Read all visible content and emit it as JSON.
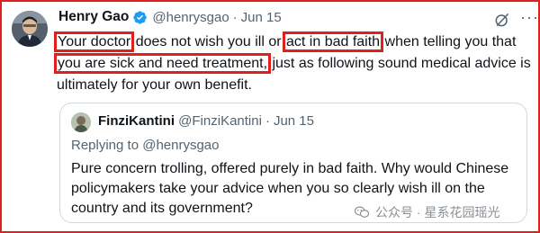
{
  "tweet": {
    "author_name": "Henry Gao",
    "author_handle": "@henrysgao",
    "separator": "·",
    "date": "Jun 15",
    "text": {
      "line1_hl1": "Your doctor",
      "line1_mid": " does not wish you ill or ",
      "line1_hl2": "act in bad faith",
      "line1_end": " when telling you that",
      "line2_hl3": "you are sick and need treatment,",
      "line2_end": " just as following sound medical advice is",
      "line3": "ultimately for your own benefit."
    },
    "highlight_color": "#e0201c"
  },
  "quoted_tweet": {
    "author_name": "FinziKantini",
    "author_handle": "@FinziKantini",
    "separator": "·",
    "date": "Jun 15",
    "replying_to": "Replying to @henrysgao",
    "text_lines": [
      "Pure concern trolling, offered purely in bad faith. Why would Chinese",
      "policymakers take your advice when you so clearly wish ill on the",
      "country and its government?"
    ]
  },
  "watermark": {
    "text": "公众号 · 星系花园瑶光",
    "icon": "wechat-icon"
  },
  "icons": {
    "verified": "verified-badge-icon",
    "grok": "grok-icon",
    "more": "more-options-icon"
  },
  "colors": {
    "verified_blue": "#1d9bf0",
    "secondary_text": "#536471",
    "border": "#cfd9de"
  }
}
